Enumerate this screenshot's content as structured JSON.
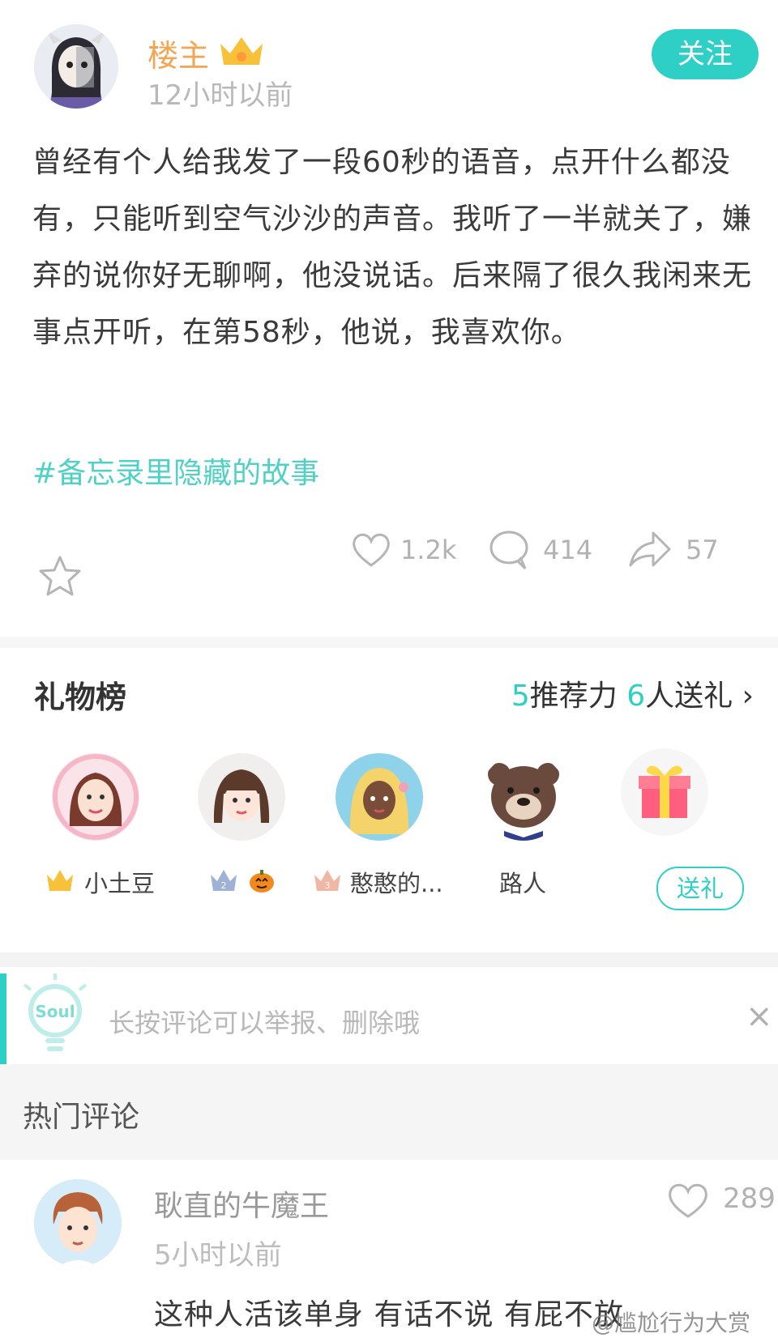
{
  "post": {
    "author": "楼主",
    "time": "12小时以前",
    "follow_label": "关注",
    "text": "曾经有个人给我发了一段60秒的语音，点开什么都没有，只能听到空气沙沙的声音。我听了一半就关了，嫌弃的说你好无聊啊，他没说话。后来隔了很久我闲来无事点开听，在第58秒，他说，我喜欢你。",
    "hashtag": "#备忘录里隐藏的故事",
    "likes": "1.2k",
    "comments": "414",
    "shares": "57"
  },
  "gifts": {
    "title": "礼物榜",
    "recommend_count": "5",
    "recommend_label": "推荐力",
    "sender_count": "6",
    "sender_label": "人送礼",
    "chevron": "›",
    "items": [
      {
        "name": "小土豆",
        "rank": "1"
      },
      {
        "name": "",
        "rank": "2"
      },
      {
        "name": "憨憨的...",
        "rank": "3"
      },
      {
        "name": "路人",
        "rank": ""
      }
    ],
    "send_label": "送礼"
  },
  "notice": {
    "badge": "Soul",
    "text": "长按评论可以举报、删除哦",
    "close": "×"
  },
  "hot_comments": {
    "title": "热门评论",
    "items": [
      {
        "name": "耿直的牛魔王",
        "time": "5小时以前",
        "likes": "289",
        "text": "这种人活该单身 有话不说 有屁不放"
      }
    ]
  },
  "watermark": "@尴尬行为大赏",
  "colors": {
    "accent": "#2ecfc4",
    "author": "#f2a552",
    "crown": "#f7c23a"
  }
}
